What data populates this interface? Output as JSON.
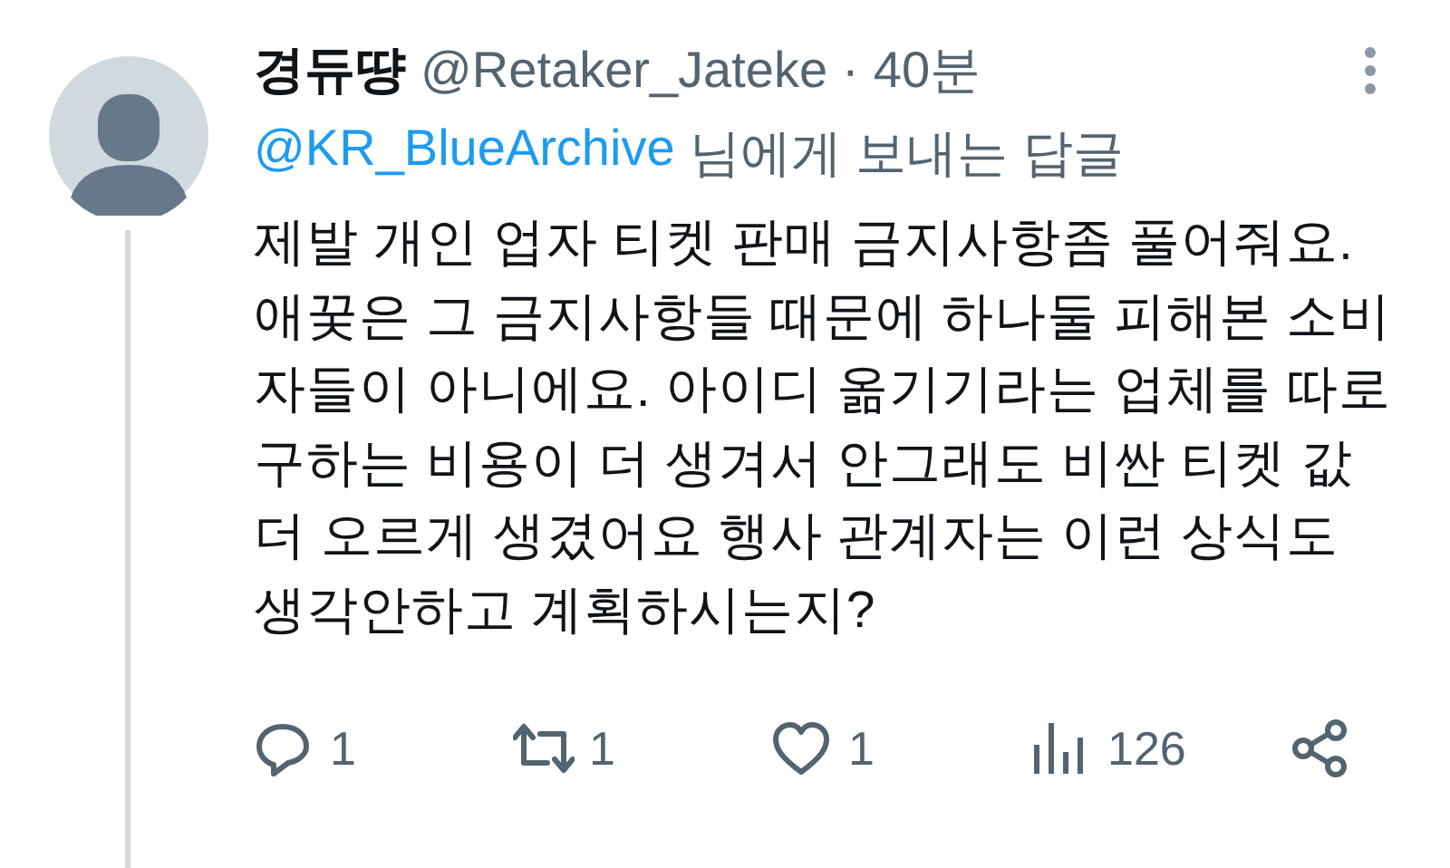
{
  "tweet": {
    "author": {
      "name": "경듀땽",
      "handle": "@Retaker_Jateke",
      "separator": "·",
      "time": "40분"
    },
    "reply_to": {
      "handle": "@KR_BlueArchive",
      "suffix": "님에게 보내는 답글"
    },
    "text": "제발 개인 업자 티켓 판매 금지사항좀 풀어줘요. 애꿎은 그 금지사항들 때문에 하나둘 피해본 소비자들이 아니에요. 아이디 옮기기라는 업체를 따로 구하는 비용이 더 생겨서 안그래도 비싼 티켓 값 더 오르게 생겼어요 행사 관계자는 이런 상식도 생각안하고 계획하시는지?",
    "actions": [
      {
        "kind": "reply",
        "count": "1"
      },
      {
        "kind": "retweet",
        "count": "1"
      },
      {
        "kind": "like",
        "count": "1"
      },
      {
        "kind": "views",
        "count": "126"
      },
      {
        "kind": "share"
      }
    ]
  }
}
